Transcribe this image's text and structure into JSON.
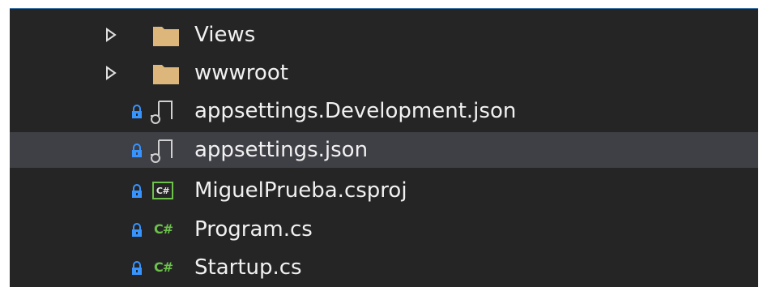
{
  "solution_explorer": {
    "items": [
      {
        "label": "Views",
        "kind": "folder",
        "expandable": true,
        "locked": false,
        "selected": false
      },
      {
        "label": "wwwroot",
        "kind": "folder",
        "expandable": true,
        "locked": false,
        "selected": false
      },
      {
        "label": "appsettings.Development.json",
        "kind": "json-file",
        "expandable": false,
        "locked": true,
        "selected": false
      },
      {
        "label": "appsettings.json",
        "kind": "json-file",
        "expandable": false,
        "locked": true,
        "selected": true
      },
      {
        "label": "MiguelPrueba.csproj",
        "kind": "csproj-file",
        "expandable": false,
        "locked": true,
        "selected": false
      },
      {
        "label": "Program.cs",
        "kind": "csharp-file",
        "expandable": false,
        "locked": true,
        "selected": false
      },
      {
        "label": "Startup.cs",
        "kind": "csharp-file",
        "expandable": false,
        "locked": true,
        "selected": false
      }
    ],
    "icons": {
      "csharp_glyph": "C#",
      "csproj_glyph": "C#"
    },
    "colors": {
      "background": "#252526",
      "selected_row": "#3f3f46",
      "folder": "#dcb67a",
      "csharp": "#6cc24a",
      "lock": "#3794ff",
      "text": "#f1f1f1"
    }
  }
}
